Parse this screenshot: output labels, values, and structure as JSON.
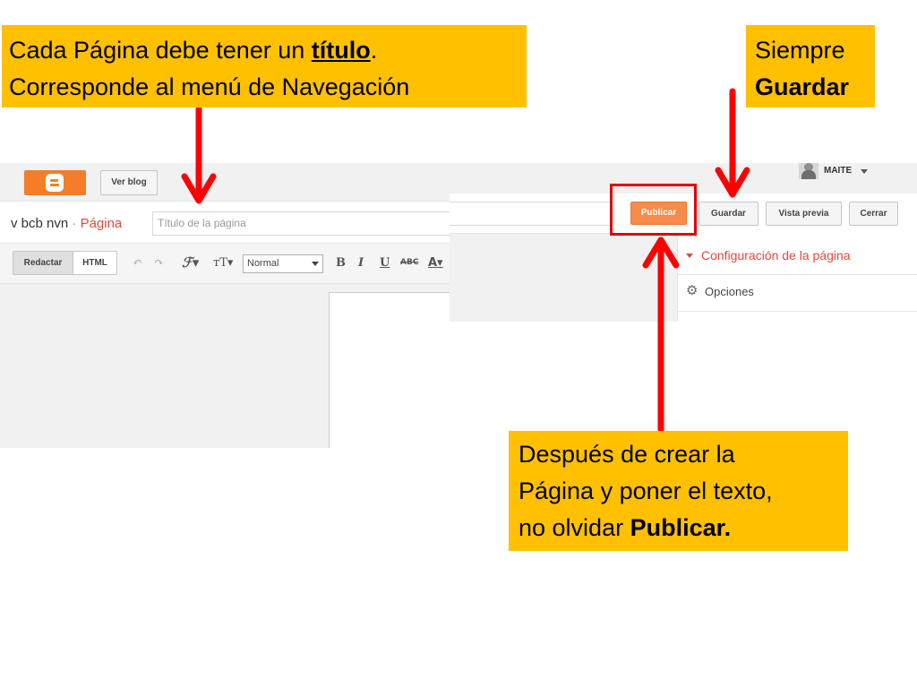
{
  "callouts": {
    "titulo": {
      "line1_pre": "Cada Página debe tener un ",
      "line1_bold": "título",
      "line1_post": ".",
      "line2": "Corresponde al menú de Navegación"
    },
    "guardar": {
      "line1": "Siempre",
      "line2_bold": "Guardar"
    },
    "publicar": {
      "line1": "Después de crear la",
      "line2": "Página y poner el texto,",
      "line3_pre": "no olvidar ",
      "line3_bold": "Publicar."
    }
  },
  "editor": {
    "ver_blog": "Ver blog",
    "blog_name": "v bcb nvn",
    "separator": " · ",
    "pagina": "Página",
    "title_placeholder": "Título de la página",
    "mode_redactar": "Redactar",
    "mode_html": "HTML",
    "font_size_value": "Normal",
    "toolbar_icons": [
      "undo-icon",
      "redo-icon",
      "font-family-icon",
      "font-size-icon",
      "bold-icon",
      "italic-icon",
      "underline-icon",
      "strikethrough-icon",
      "text-color-icon"
    ]
  },
  "header": {
    "user": "MAITE"
  },
  "actions": {
    "publicar": "Publicar",
    "guardar": "Guardar",
    "vista_previa": "Vista previa",
    "cerrar": "Cerrar"
  },
  "sidebar": {
    "config": "Configuración de la página",
    "opciones": "Opciones"
  },
  "colors": {
    "callout": "#FFC000",
    "arrow": "#FF0000",
    "publish_button": "#F68B4A",
    "accent_red": "#DD4B39"
  }
}
